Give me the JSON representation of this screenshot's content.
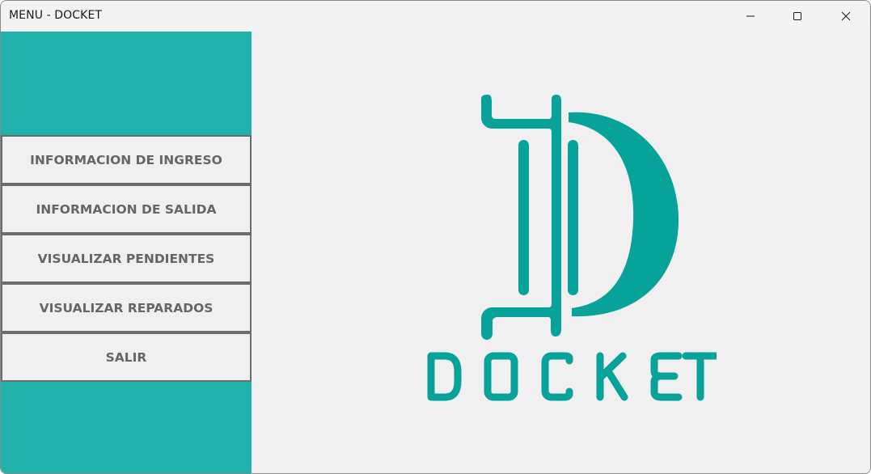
{
  "window": {
    "title": "MENU - DOCKET",
    "controls": {
      "minimize_icon": "minimize-icon",
      "maximize_icon": "maximize-icon",
      "close_icon": "close-icon"
    }
  },
  "sidebar": {
    "background_color": "#20b2aa",
    "items": [
      {
        "label": "INFORMACION DE INGRESO"
      },
      {
        "label": "INFORMACION DE SALIDA"
      },
      {
        "label": "VISUALIZAR PENDIENTES"
      },
      {
        "label": "VISUALIZAR REPARADOS"
      },
      {
        "label": "SALIR"
      }
    ]
  },
  "main": {
    "logo": {
      "icon": "docket-logo-icon",
      "wordmark": "DOCKET",
      "color": "#07a39b"
    }
  }
}
